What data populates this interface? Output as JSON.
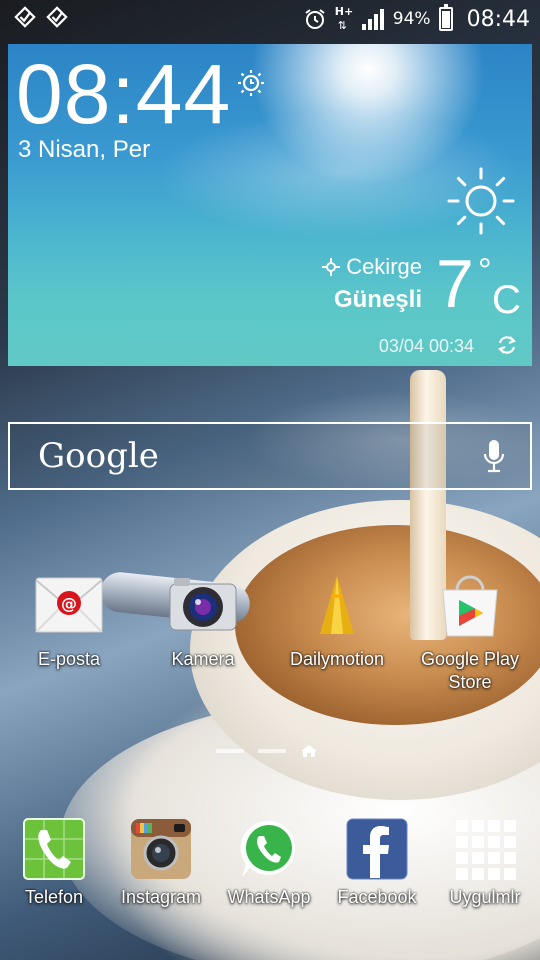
{
  "status_bar": {
    "left_icons": [
      "dropbox-notification-icon",
      "dropbox-notification-icon"
    ],
    "right_icons": [
      "alarm-icon",
      "hspa-plus-icon",
      "signal-icon"
    ],
    "network": "H+",
    "battery_percent": "94%",
    "battery_level": 0.94,
    "time": "08:44"
  },
  "weather_widget": {
    "time": "08:44",
    "date": "3 Nisan, Per",
    "location": "Cekirge",
    "condition": "Güneşli",
    "temperature": "7",
    "degree_symbol": "°",
    "unit": "C",
    "updated": "03/04 00:34",
    "icons": [
      "alarm-clock-icon",
      "sun-icon",
      "location-icon",
      "refresh-icon"
    ]
  },
  "search_bar": {
    "logo": "Google",
    "icon": "microphone-icon"
  },
  "home_apps": [
    {
      "label": "E-posta",
      "icon": "email-icon"
    },
    {
      "label": "Kamera",
      "icon": "camera-icon"
    },
    {
      "label": "Dailymotion",
      "icon": "dailymotion-icon"
    },
    {
      "label": "Google Play Store",
      "icon": "play-store-icon"
    }
  ],
  "page_indicator": {
    "pages": 3,
    "current": "home"
  },
  "dock": [
    {
      "label": "Telefon",
      "icon": "phone-icon"
    },
    {
      "label": "Instagram",
      "icon": "instagram-icon"
    },
    {
      "label": "WhatsApp",
      "icon": "whatsapp-icon"
    },
    {
      "label": "Facebook",
      "icon": "facebook-icon"
    },
    {
      "label": "Uygulmlr",
      "icon": "apps-grid-icon"
    }
  ],
  "colors": {
    "sky_top": "#2c84c6",
    "sky_bottom": "#60c9c6",
    "text": "#ffffff"
  }
}
